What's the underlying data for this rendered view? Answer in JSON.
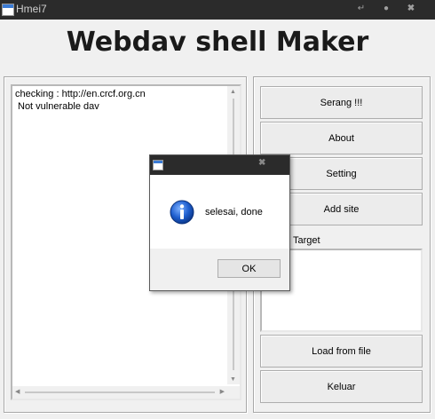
{
  "window": {
    "title": "Hmei7"
  },
  "header": {
    "title": "Webdav shell Maker"
  },
  "log": {
    "lines": [
      "checking : http://en.crcf.org.cn",
      "Not vulnerable dav"
    ]
  },
  "buttons": {
    "serang": "Serang !!!",
    "about": "About",
    "setting": "Setting",
    "add_site": "Add site",
    "load_from_file": "Load from file",
    "keluar": "Keluar"
  },
  "target": {
    "label": "Target",
    "value": ""
  },
  "dialog": {
    "message": "selesai, done",
    "ok": "OK",
    "icon": "info-icon"
  }
}
